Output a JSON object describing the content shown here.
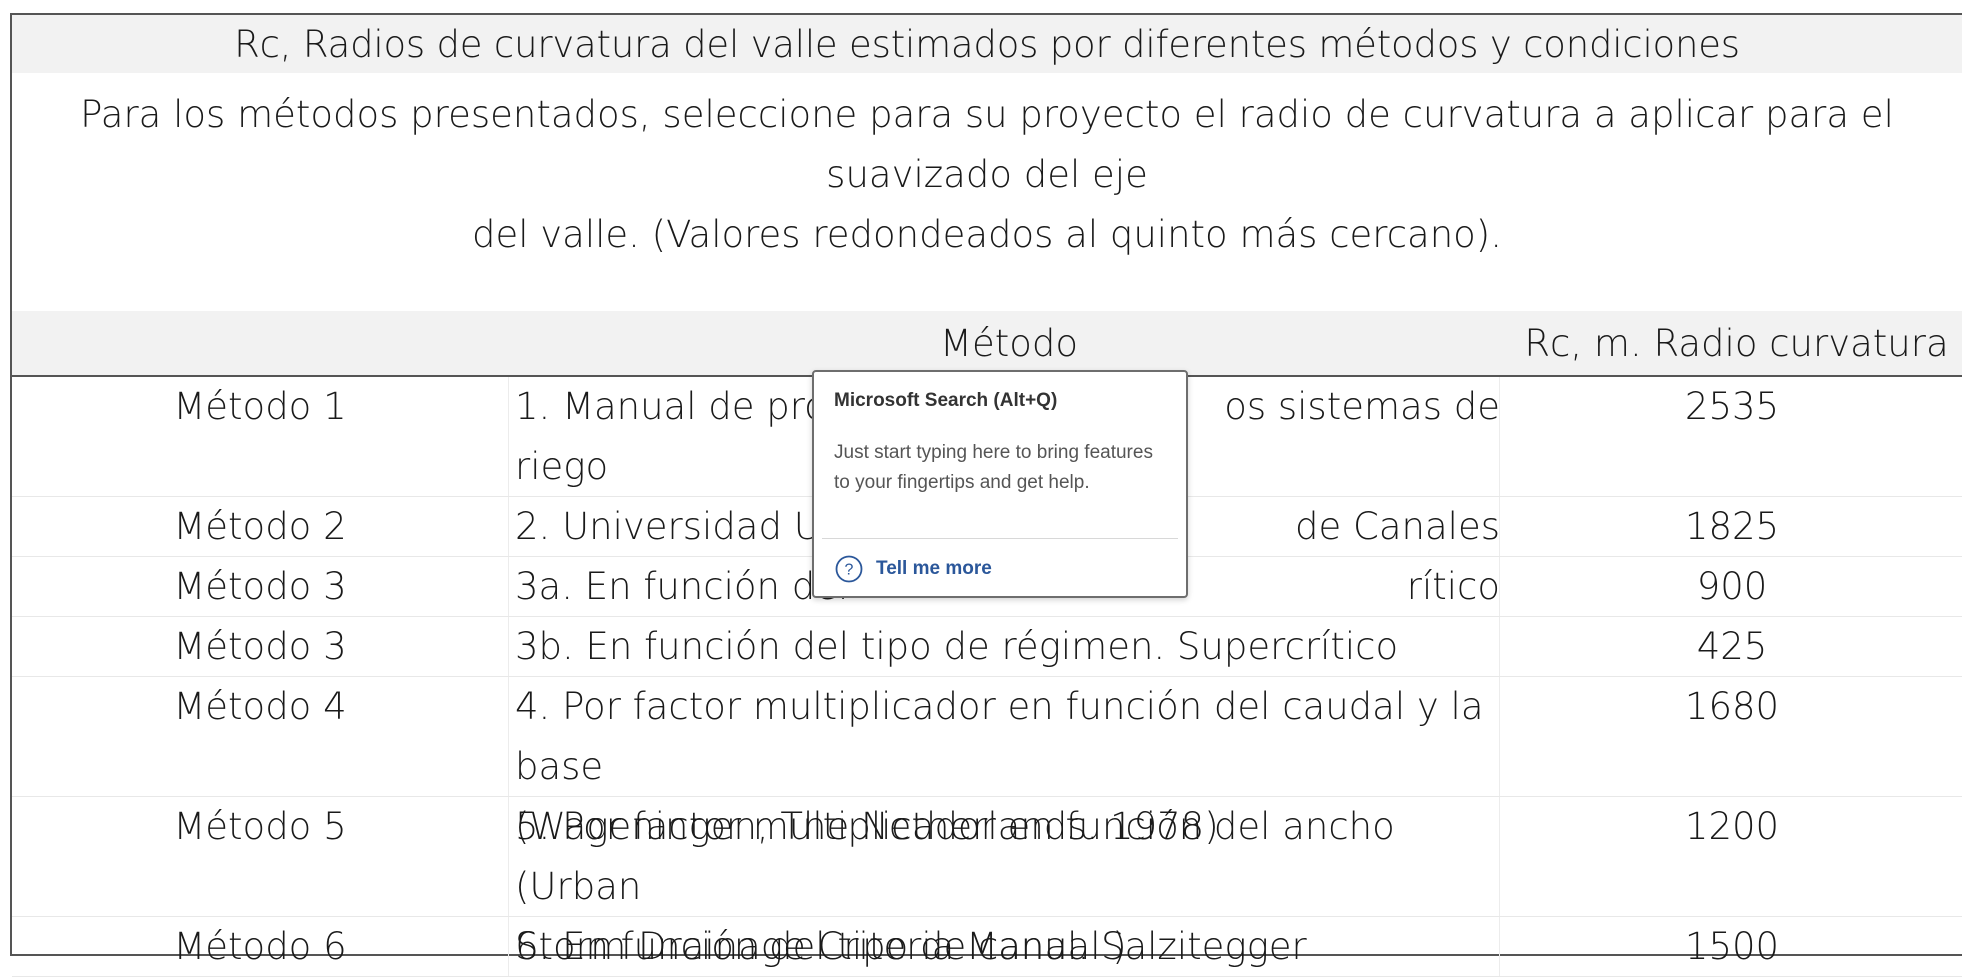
{
  "title": "Rc, Radios de curvatura del valle estimados por diferentes métodos y condiciones",
  "subtitle_line1": "Para los métodos presentados, seleccione para su proyecto el radio de curvatura a aplicar para el suavizado del eje",
  "subtitle_line2": "del valle. (Valores redondeados al quinto más cercano).",
  "headers": {
    "metodo": "Método",
    "rc": "Rc, m. Radio curvatura"
  },
  "rows": [
    {
      "label": "Método 1",
      "desc_lines": [
        "1. Manual de proce",
        "riego"
      ],
      "desc_tail": "os sistemas de",
      "value": "2535"
    },
    {
      "label": "Método 2",
      "desc_lines": [
        "2. Universidad Uta"
      ],
      "desc_tail": "de Canales",
      "value": "1825"
    },
    {
      "label": "Método 3",
      "desc_lines": [
        "3a. En función del"
      ],
      "desc_tail": "rítico",
      "value": "900"
    },
    {
      "label": "Método 3",
      "desc_lines": [
        "3b. En función del tipo de régimen. Supercrítico"
      ],
      "desc_tail": "",
      "value": "425"
    },
    {
      "label": "Método 4",
      "desc_lines": [
        "4. Por factor multiplicador en función del caudal y la base",
        "(Wageningen, The Netherlands. 1978)"
      ],
      "desc_tail": "",
      "value": "1680"
    },
    {
      "label": "Método 5",
      "desc_lines": [
        "5. Por factor multiplicador en función del ancho (Urban",
        "Storm Drainage Criteria Manual )"
      ],
      "desc_tail": "",
      "value": "1200"
    },
    {
      "label": "Método 6",
      "desc_lines": [
        "6. En función del tipo de canal. Salzitegger"
      ],
      "desc_tail": "",
      "value": "1500"
    }
  ],
  "tooltip": {
    "title": "Microsoft Search (Alt+Q)",
    "body": "Just start typing here to bring features to your fingertips and get help.",
    "link": "Tell me more",
    "icon": "help-circle-icon",
    "accent": "#2b579a"
  }
}
